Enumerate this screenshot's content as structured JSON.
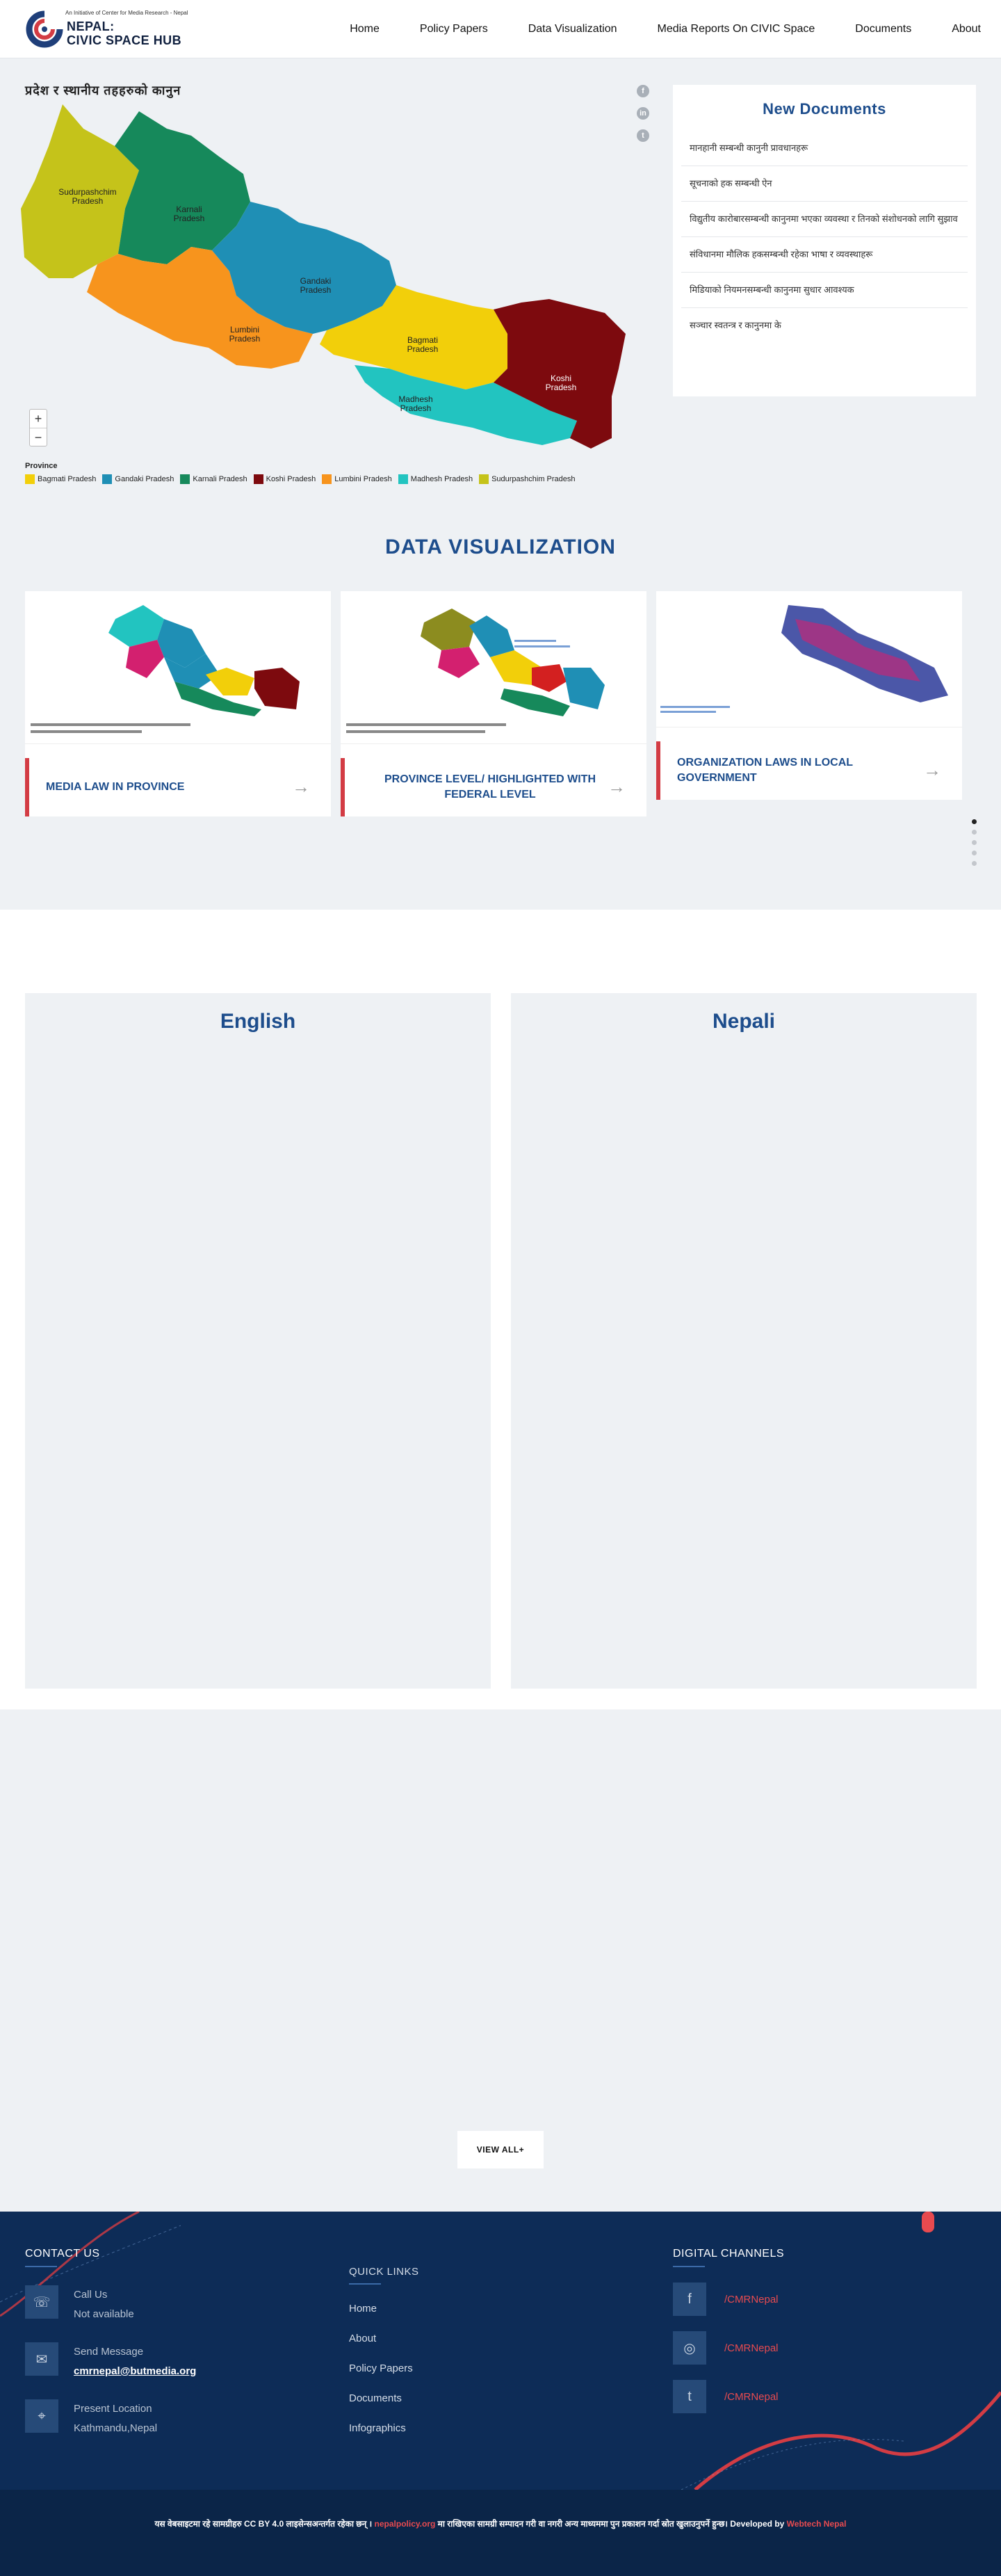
{
  "header": {
    "logo_tagline": "An Initiative of Center for Media Research - Nepal",
    "logo_line1": "NEPAL:",
    "logo_line2": "CIVIC SPACE HUB",
    "nav": [
      "Home",
      "Policy Papers",
      "Data Visualization",
      "Media Reports On CIVIC Space",
      "Documents",
      "About"
    ]
  },
  "hero": {
    "map_title": "प्रदेश र स्थानीय तहहरुको कानुन",
    "zoom_in": "+",
    "zoom_out": "−",
    "legend_title": "Province",
    "provinces": [
      {
        "name": "Bagmati Pradesh",
        "color": "#f2cf0a"
      },
      {
        "name": "Gandaki Pradesh",
        "color": "#1f8fb5"
      },
      {
        "name": "Karnali Pradesh",
        "color": "#16895b"
      },
      {
        "name": "Koshi Pradesh",
        "color": "#7d0a0e"
      },
      {
        "name": "Lumbini Pradesh",
        "color": "#f7941d"
      },
      {
        "name": "Madhesh Pradesh",
        "color": "#22c4c0"
      },
      {
        "name": "Sudurpashchim Pradesh",
        "color": "#c5c31a"
      }
    ],
    "map_labels": {
      "sudur": [
        "Sudurpashchim",
        "Pradesh"
      ],
      "karnali": [
        "Karnali",
        "Pradesh"
      ],
      "gandaki": [
        "Gandaki",
        "Pradesh"
      ],
      "lumbini": [
        "Lumbini",
        "Pradesh"
      ],
      "bagmati": [
        "Bagmati",
        "Pradesh"
      ],
      "madhesh": [
        "Madhesh",
        "Pradesh"
      ],
      "koshi": [
        "Koshi",
        "Pradesh"
      ]
    },
    "share_icons": [
      "facebook-icon",
      "linkedin-icon",
      "twitter-icon"
    ]
  },
  "new_documents": {
    "title": "New Documents",
    "items": [
      "मानहानी सम्बन्धी कानुनी प्रावधानहरू",
      "सूचनाको हक सम्बन्धी ऐन",
      "विद्युतीय कारोबारसम्बन्धी कानुनमा भएका व्यवस्था र तिनको संशोधनको लागि सुझाव",
      "संविधानमा मौलिक हकसम्बन्धी रहेका भाषा र व्यवस्थाहरू",
      "मिडियाको नियमनसम्बन्धी कानुनमा सुधार आवश्यक",
      "सञ्चार स्वतन्त्र र कानुनमा के"
    ]
  },
  "data_viz": {
    "title": "DATA VISUALIZATION",
    "cards": [
      {
        "caption": "MEDIA LAW IN PROVINCE"
      },
      {
        "caption": "PROVINCE LEVEL/ HIGHLIGHTED WITH FEDERAL LEVEL"
      },
      {
        "caption": "ORGANIZATION LAWS IN LOCAL GOVERNMENT"
      }
    ]
  },
  "languages": {
    "english": "English",
    "nepali": "Nepali"
  },
  "view_all": "VIEW ALL+",
  "footer": {
    "contact_title": "CONTACT US",
    "call_label": "Call Us",
    "call_value": "Not available",
    "msg_label": "Send Message",
    "msg_value": "cmrnepal@butmedia.org",
    "loc_label": "Present Location",
    "loc_value": "Kathmandu,Nepal",
    "quick_title": "QUICK LINKS",
    "quick_links": [
      "Home",
      "About",
      "Policy Papers",
      "Documents",
      "Infographics"
    ],
    "digital_title": "DIGITAL CHANNELS",
    "channels": [
      "/CMRNepal",
      "/CMRNepal",
      "/CMRNepal"
    ]
  },
  "copyright": {
    "pre": "यस वेबसाइटमा रहे सामग्रीहरु CC BY 4.0 लाइसेन्सअन्तर्गत रहेका छन् । ",
    "site": "nepalpolicy.org",
    "mid": " मा राखिएका सामग्री सम्पादन गरी वा नगरी अन्य माध्यममा पुन प्रकाशन गर्दा स्रोत खुलाउनुपर्ने हुन्छ। Developed by ",
    "dev": "Webtech Nepal"
  },
  "colors": {
    "brand_blue": "#1d4d8c",
    "accent_red": "#d33c44",
    "footer_bg": "#0d2c57"
  }
}
